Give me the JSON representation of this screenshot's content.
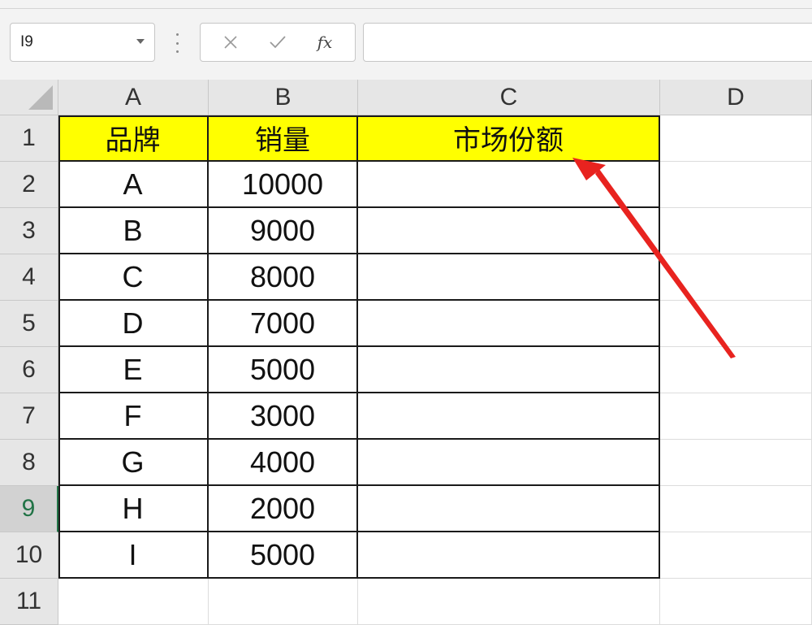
{
  "formula_bar": {
    "name_box": "I9",
    "cancel_symbol": "✕",
    "enter_symbol": "✓",
    "fx_label": "fx",
    "formula_value": ""
  },
  "sheet": {
    "columns": [
      "A",
      "B",
      "C",
      "D"
    ],
    "rows": [
      "1",
      "2",
      "3",
      "4",
      "5",
      "6",
      "7",
      "8",
      "9",
      "10",
      "11"
    ],
    "active_row": "9",
    "header_row": [
      "品牌",
      "销量",
      "市场份额"
    ],
    "data_rows": [
      [
        "A",
        "10000",
        ""
      ],
      [
        "B",
        "9000",
        ""
      ],
      [
        "C",
        "8000",
        ""
      ],
      [
        "D",
        "7000",
        ""
      ],
      [
        "E",
        "5000",
        ""
      ],
      [
        "F",
        "3000",
        ""
      ],
      [
        "G",
        "4000",
        ""
      ],
      [
        "H",
        "2000",
        ""
      ],
      [
        "I",
        "5000",
        ""
      ]
    ]
  },
  "colors": {
    "header_fill": "#ffff00",
    "arrow": "#e8231f",
    "selection_accent": "#217346"
  },
  "icons": {
    "arrow": "red-pointer-arrow",
    "cancel": "cross-icon",
    "enter": "check-icon",
    "function": "fx-icon"
  }
}
